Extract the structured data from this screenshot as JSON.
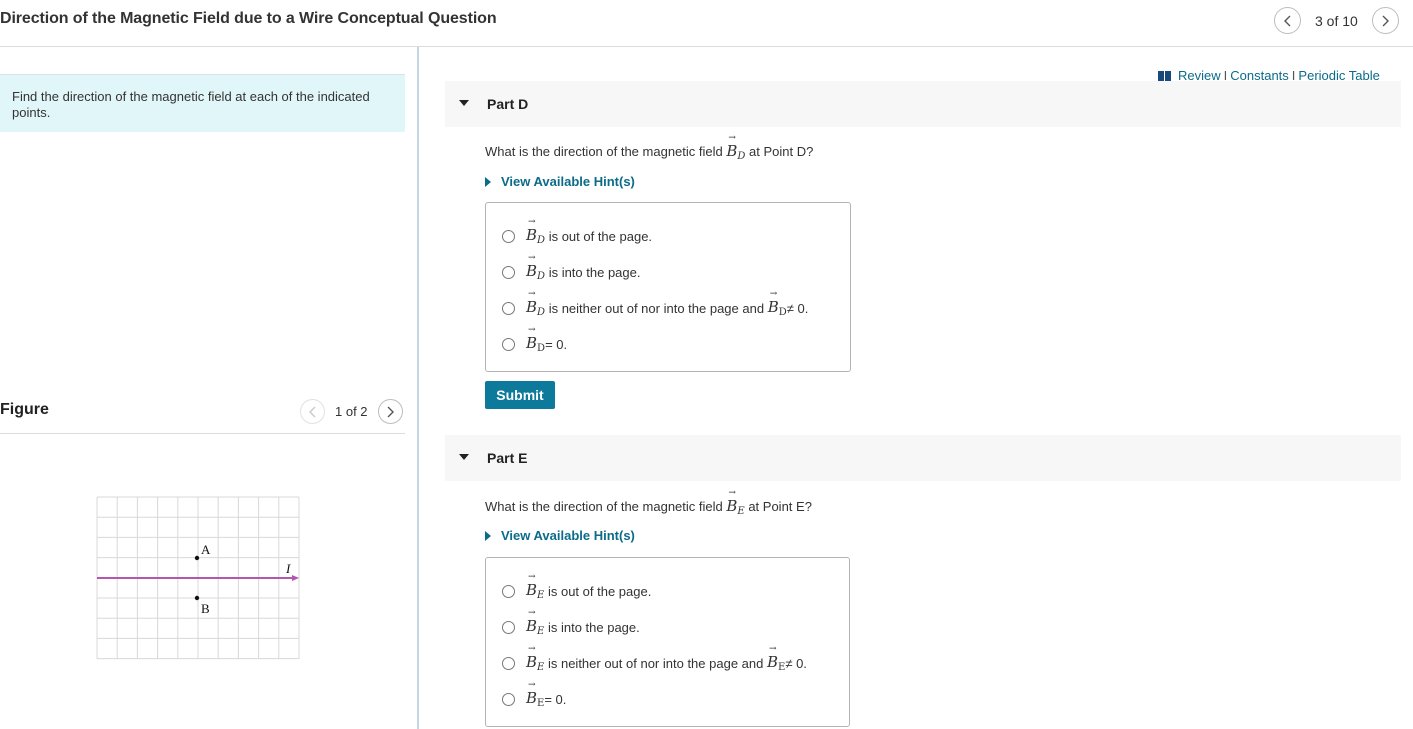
{
  "header": {
    "title": "Direction of the Magnetic Field due to a Wire Conceptual Question",
    "pager_text": "3 of 10",
    "prev_icon": "chevron-left-icon",
    "next_icon": "chevron-right-icon"
  },
  "intro": {
    "text": "Find the direction of the magnetic field at each of the indicated points."
  },
  "figure": {
    "title": "Figure",
    "pager_text": "1 of 2",
    "labels": {
      "point_a": "A",
      "point_b": "B",
      "current": "I"
    },
    "wire_color": "#b455b0"
  },
  "links": {
    "icon": "book-icon",
    "review": "Review",
    "constants": "Constants",
    "periodic_table": "Periodic Table",
    "separator": "I"
  },
  "parts": [
    {
      "label": "Part D",
      "question_prefix": "What is the direction of the magnetic field",
      "symbol": "B",
      "sub": "D",
      "question_suffix": "at Point D?",
      "hint_label": "View Available Hint(s)",
      "choices": [
        {
          "text": "is out of the page."
        },
        {
          "text": "is into the page."
        },
        {
          "text": "is neither out of nor into the page and",
          "tail": "≠ 0."
        },
        {
          "text": "",
          "tail": "= 0."
        }
      ],
      "submit_label": "Submit"
    },
    {
      "label": "Part E",
      "question_prefix": "What is the direction of the magnetic field",
      "symbol": "B",
      "sub": "E",
      "question_suffix": "at Point E?",
      "hint_label": "View Available Hint(s)",
      "choices": [
        {
          "text": "is out of the page."
        },
        {
          "text": "is into the page."
        },
        {
          "text": "is neither out of nor into the page and",
          "tail": "≠ 0."
        },
        {
          "text": "",
          "tail": "= 0."
        }
      ]
    }
  ],
  "colors": {
    "accent": "#0b6b8a",
    "submit_bg": "#0d7a9b",
    "intro_bg": "#e1f6f8",
    "part_header_bg": "#f7f7f7"
  }
}
